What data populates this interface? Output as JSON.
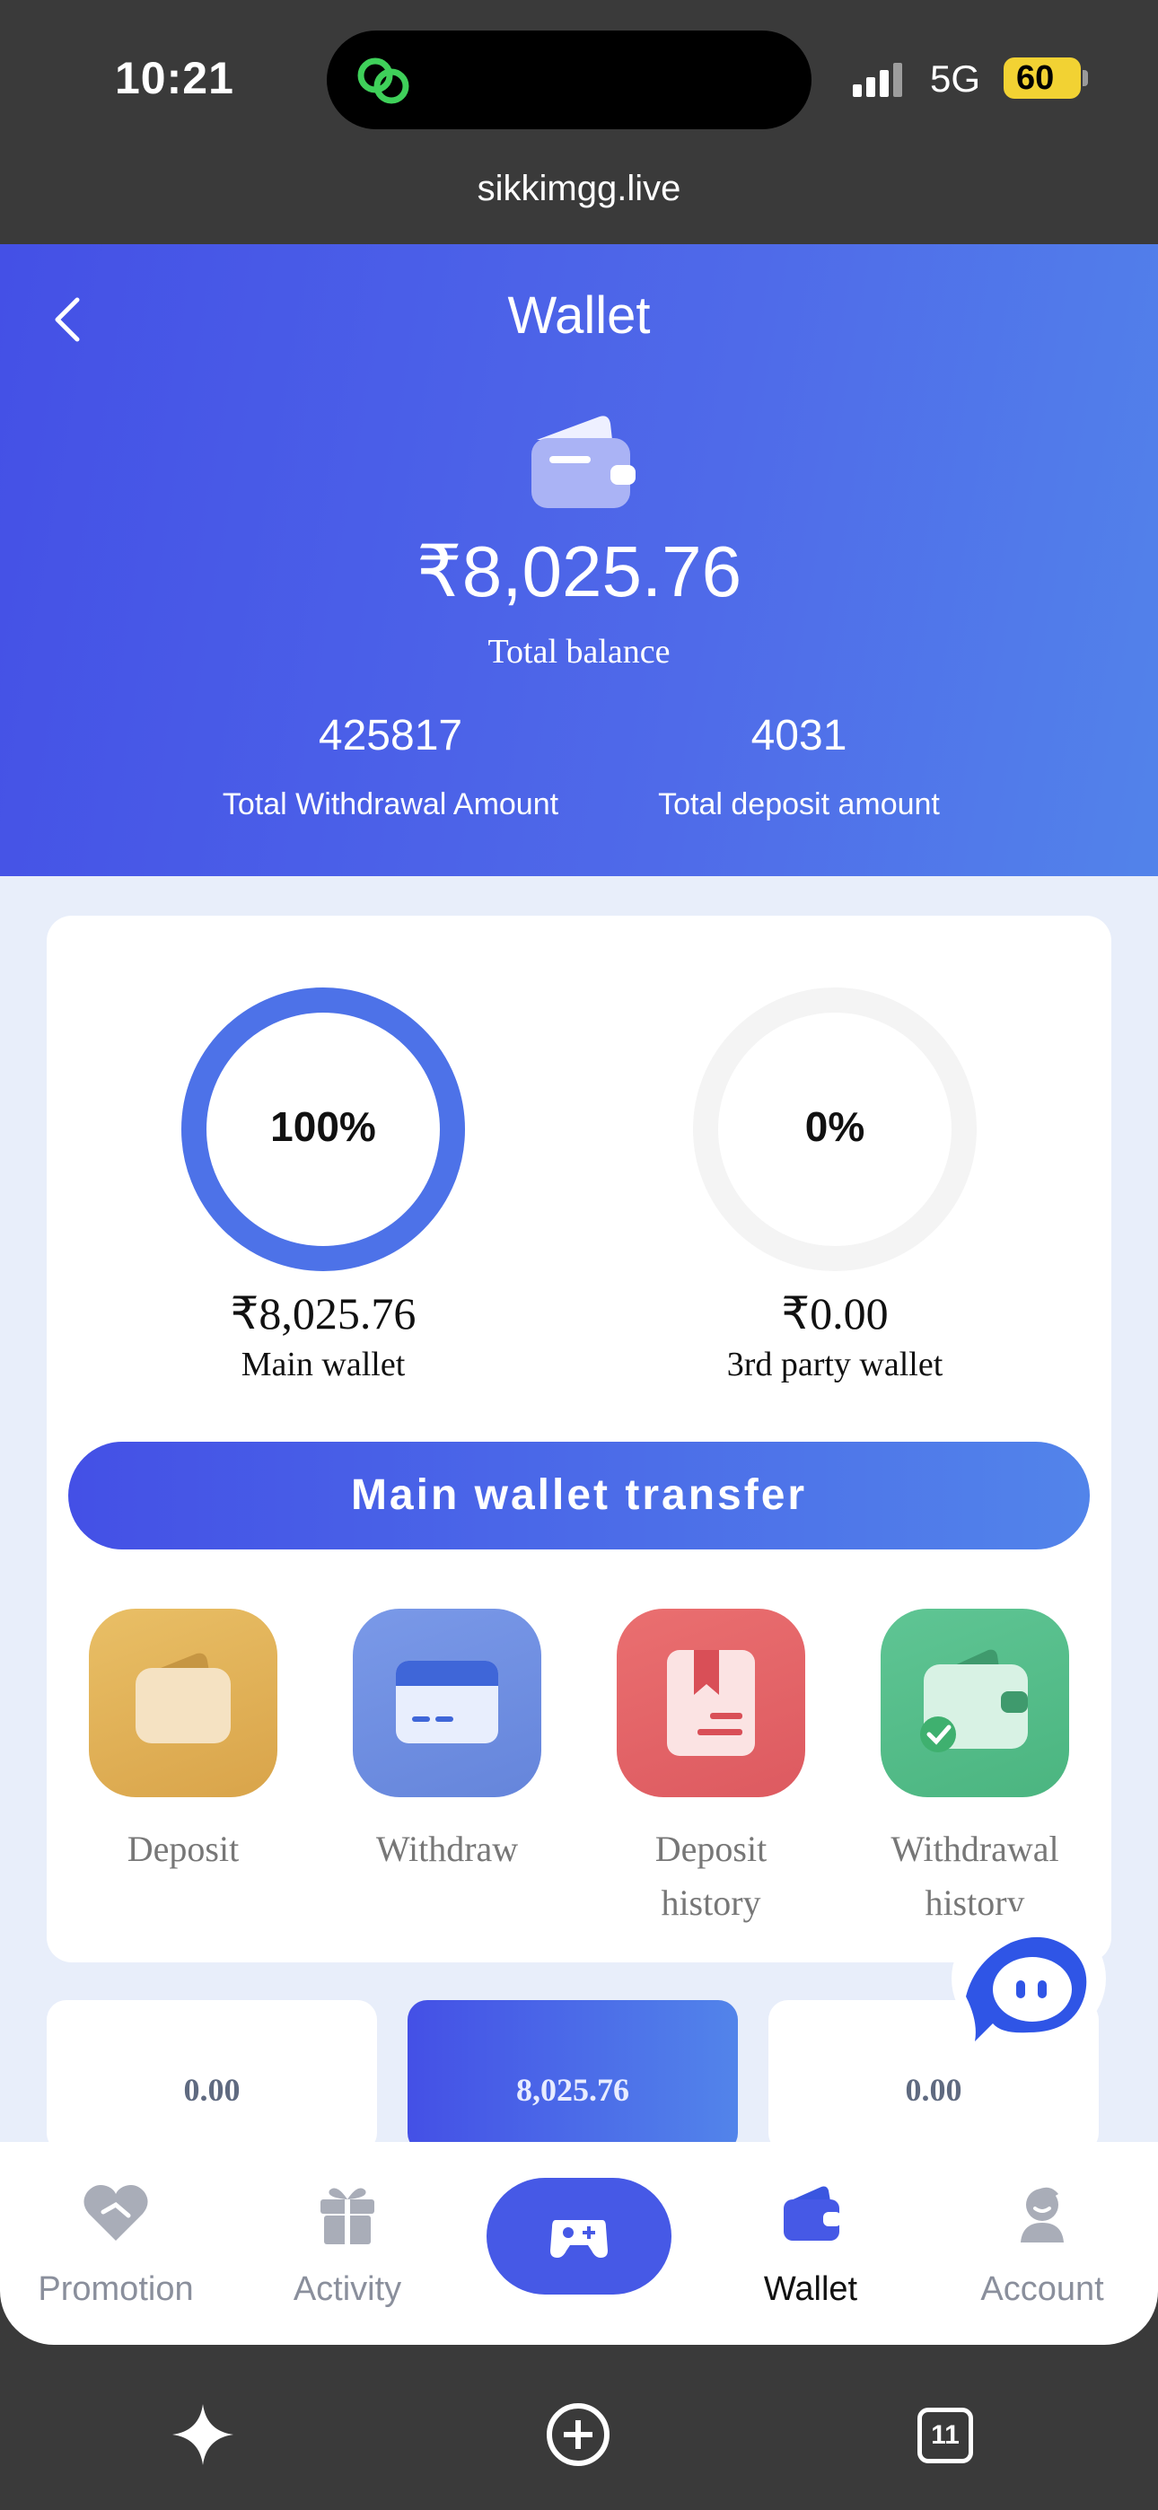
{
  "status_bar": {
    "time": "10:21",
    "network": "5G",
    "battery": "60",
    "battery_color": "#f2d233"
  },
  "browser": {
    "url": "sikkimgg.live"
  },
  "header": {
    "title": "Wallet",
    "total_balance": "₹8,025.76",
    "total_balance_label": "Total balance",
    "withdrawal_amount": "425817",
    "withdrawal_label": "Total Withdrawal Amount",
    "deposit_amount": "4031",
    "deposit_label": "Total deposit amount",
    "gradient_start": "#4450e6",
    "gradient_end": "#5283ea"
  },
  "wallets": {
    "main": {
      "percent_label": "100%",
      "fill_fraction": 1.0,
      "amount": "₹8,025.76",
      "name": "Main wallet"
    },
    "third_party": {
      "percent_label": "0%",
      "fill_fraction": 0.0,
      "amount": "₹0.00",
      "name": "3rd party wallet"
    }
  },
  "transfer_button": {
    "label": "Main wallet transfer"
  },
  "actions": [
    {
      "label_line1": "Deposit",
      "label_line2": "",
      "icon": "deposit-wallet-icon",
      "color": "#e2b45c"
    },
    {
      "label_line1": "Withdraw",
      "label_line2": "",
      "icon": "withdraw-card-icon",
      "color": "#6f90e2"
    },
    {
      "label_line1": "Deposit",
      "label_line2": "history",
      "icon": "deposit-history-icon",
      "color": "#e6676b"
    },
    {
      "label_line1": "Withdrawal",
      "label_line2": "history",
      "icon": "withdrawal-history-icon",
      "color": "#5fc594"
    }
  ],
  "mini_cards": [
    "0.00",
    "8,025.76",
    "0.00"
  ],
  "tabbar": {
    "tabs": [
      {
        "label": "Promotion",
        "icon": "promotion-heart-icon"
      },
      {
        "label": "Activity",
        "icon": "gift-icon"
      },
      {
        "label": "",
        "icon": "gamepad-icon"
      },
      {
        "label": "Wallet",
        "icon": "wallet-icon"
      },
      {
        "label": "Account",
        "icon": "account-avatar-icon"
      }
    ],
    "active": "Wallet"
  },
  "system_bar": {
    "tabs_count": "11"
  }
}
